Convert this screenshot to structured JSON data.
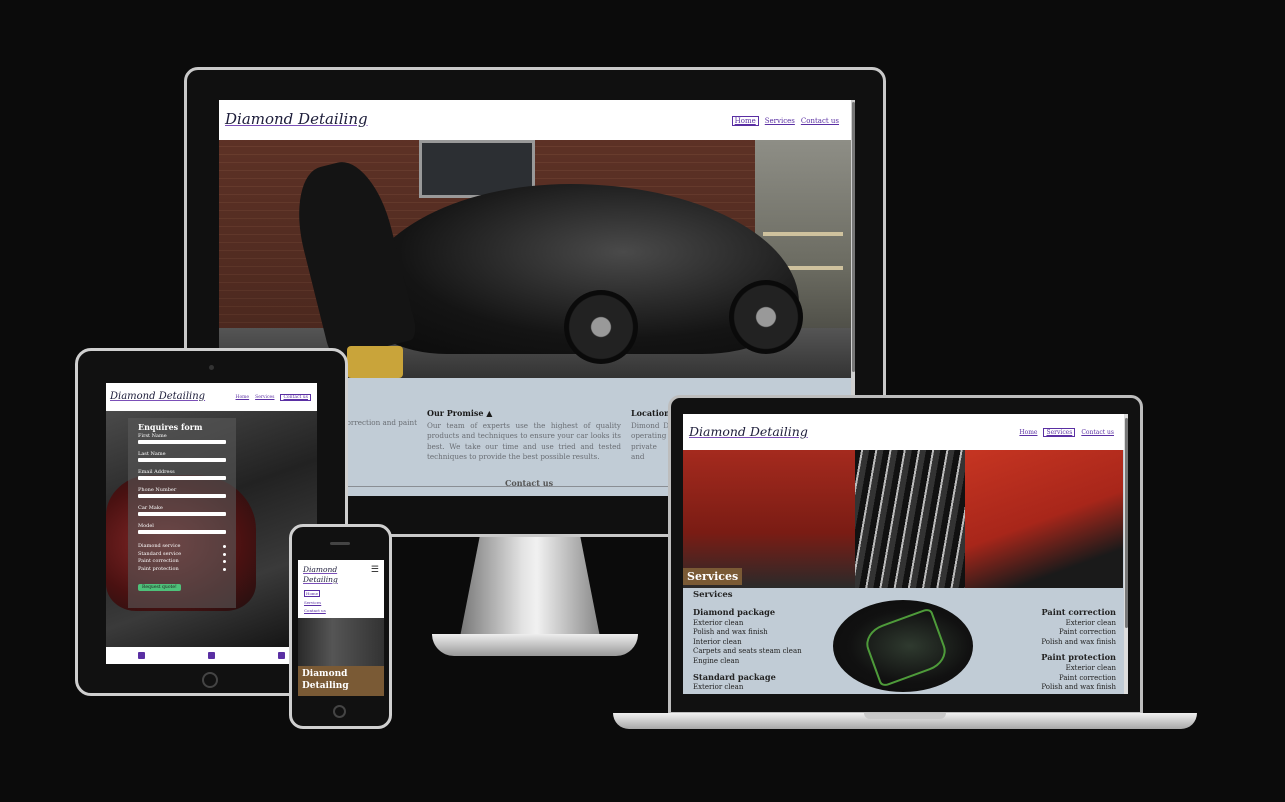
{
  "site": {
    "logo": "Diamond Detailing",
    "nav": [
      "Home",
      "Services",
      "Contact us"
    ]
  },
  "desktop": {
    "columns": [
      {
        "title": "",
        "text": "services, including correction and paint"
      },
      {
        "title": "Our Promise",
        "icon": "car-icon",
        "text": "Our team of experts use the highest of quality products and techniques to ensure your car looks its best. We take our time and use tried and tested techniques to provide the best possible results."
      },
      {
        "title": "Location",
        "text": "Dimond D operating private and"
      }
    ],
    "footer_link": "Contact us"
  },
  "tablet": {
    "form_title": "Enquires form",
    "fields": [
      "First Name",
      "Last Name",
      "Email Address",
      "Phone Number",
      "Car Make",
      "Model"
    ],
    "checkboxes": [
      "Diamond service",
      "Standard service",
      "Paint correction",
      "Paint protection"
    ],
    "submit": "Request quote!",
    "social": [
      "facebook-icon",
      "instagram-icon",
      "twitter-icon"
    ]
  },
  "phone": {
    "logo_line1": "Diamond",
    "logo_line2": "Detailing",
    "nav": [
      "Home",
      "Services",
      "Contact us"
    ],
    "hero_title_line1": "Diamond",
    "hero_title_line2": "Detailing"
  },
  "laptop": {
    "hero_label": "Services",
    "section_title": "Services",
    "left_packages": [
      {
        "title": "Diamond package",
        "items": [
          "Exterior clean",
          "Polish and wax finish",
          "Interior clean",
          "Carpets and seats steam clean",
          "Engine clean"
        ]
      },
      {
        "title": "Standard package",
        "items": [
          "Exterior clean"
        ]
      }
    ],
    "right_packages": [
      {
        "title": "Paint correction",
        "items": [
          "Exterior clean",
          "Paint correction",
          "Polish and wax finish"
        ]
      },
      {
        "title": "Paint protection",
        "items": [
          "Exterior clean",
          "Paint correction",
          "Polish and wax finish"
        ]
      }
    ]
  },
  "colors": {
    "accent": "#5a2fa3",
    "brown": "#7a5a35",
    "section_bg": "#c1ccd6",
    "button": "#4ec27a"
  }
}
